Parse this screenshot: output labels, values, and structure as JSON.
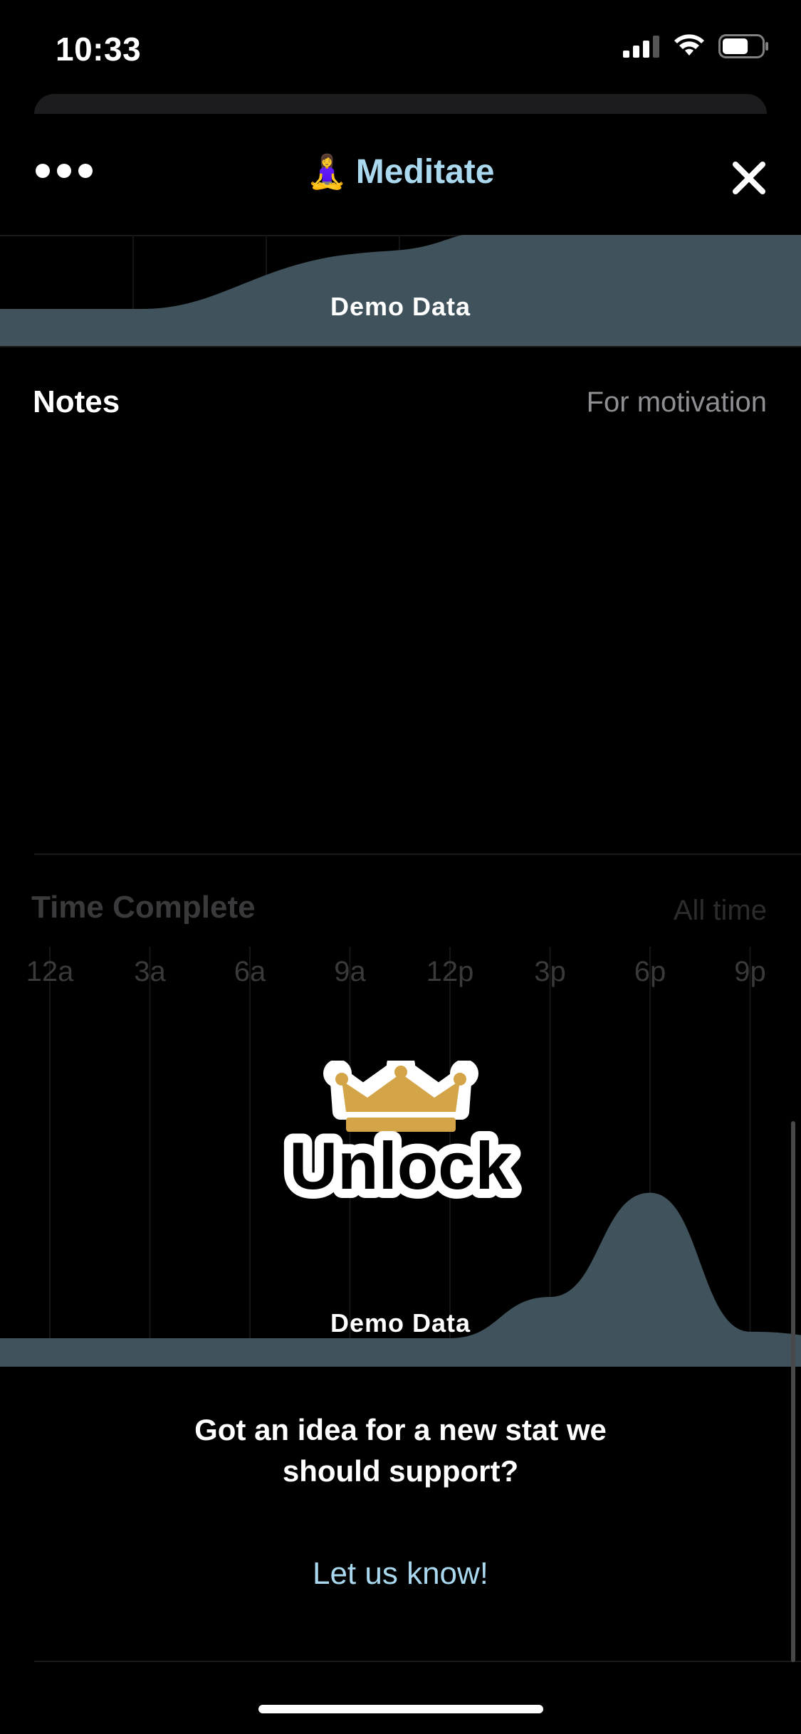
{
  "status_bar": {
    "time": "10:33",
    "battery_level": 0.65
  },
  "header": {
    "more_icon": "ellipsis-icon",
    "emoji": "🧘‍♀️",
    "title": "Meditate",
    "close_icon": "close-icon"
  },
  "top_chart": {
    "watermark": "Demo Data"
  },
  "notes": {
    "title": "Notes",
    "subtitle": "For motivation"
  },
  "time_complete": {
    "title": "Time Complete",
    "range": "All time",
    "watermark": "Demo Data",
    "unlock_label": "Unlock",
    "unlock_icon": "crown-icon"
  },
  "chart_data": {
    "type": "area",
    "categories": [
      "12a",
      "3a",
      "6a",
      "9a",
      "12p",
      "3p",
      "6p",
      "9p"
    ],
    "x": [
      0,
      3,
      6,
      9,
      12,
      15,
      18,
      21,
      24
    ],
    "values": [
      0,
      0,
      0,
      0,
      0,
      0.19,
      0.67,
      0.03,
      0
    ]
  },
  "feedback": {
    "line1": "Got an idea for a new stat we",
    "line2": "should support?",
    "link": "Let us know!"
  },
  "colors": {
    "accent": "#a9d8ef",
    "chart_fill": "#40535c",
    "gold": "#d4a548"
  }
}
